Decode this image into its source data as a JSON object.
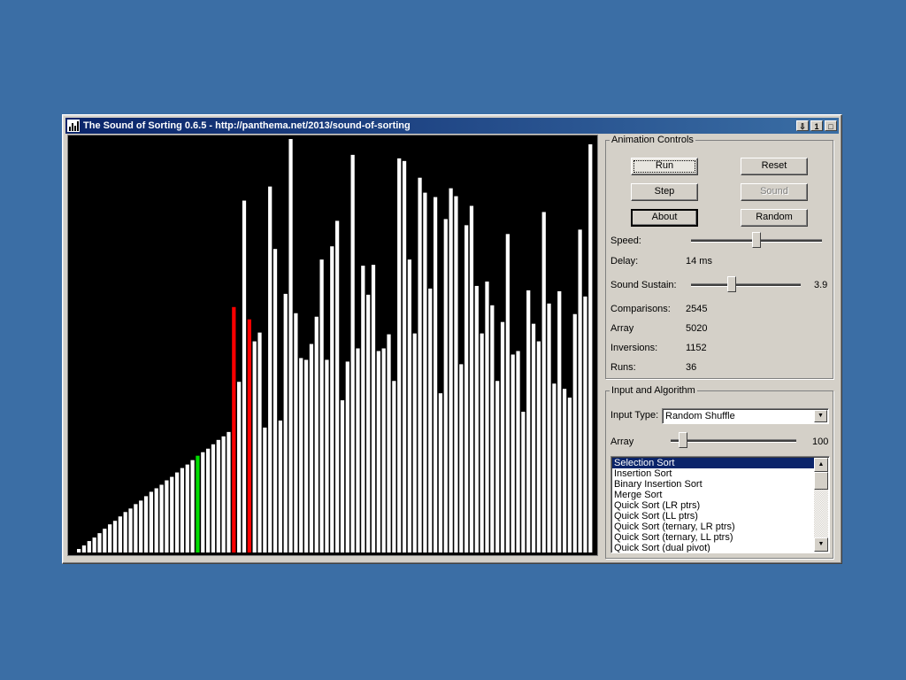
{
  "window": {
    "title": "The Sound of Sorting 0.6.5 - http://panthema.net/2013/sound-of-sorting",
    "buttons": [
      "⇩",
      "1",
      "□"
    ]
  },
  "visual": {
    "bar_color": "#ffffff",
    "compare_color": "#ff0000",
    "current_color": "#00dd00",
    "heights": [
      4,
      8,
      13,
      17,
      22,
      27,
      32,
      36,
      41,
      46,
      50,
      55,
      59,
      64,
      69,
      73,
      77,
      82,
      86,
      91,
      96,
      100,
      105,
      110,
      114,
      118,
      123,
      128,
      132,
      137,
      279,
      194,
      400,
      265,
      240,
      250,
      142,
      416,
      345,
      150,
      294,
      470,
      272,
      221,
      219,
      237,
      268,
      333,
      219,
      348,
      377,
      173,
      217,
      452,
      232,
      326,
      293,
      327,
      229,
      232,
      248,
      195,
      448,
      445,
      333,
      249,
      426,
      409,
      300,
      404,
      181,
      379,
      414,
      405,
      214,
      372,
      394,
      303,
      249,
      308,
      281,
      195,
      262,
      362,
      225,
      229,
      160,
      298,
      260,
      240,
      387,
      283,
      192,
      297,
      186,
      176,
      271,
      367,
      291,
      464
    ],
    "compare_indices": [
      30,
      33
    ],
    "current_index": 23
  },
  "animation_controls": {
    "legend": "Animation Controls",
    "run_label": "Run",
    "reset_label": "Reset",
    "step_label": "Step",
    "sound_label": "Sound",
    "about_label": "About",
    "random_label": "Random",
    "speed_label": "Speed:",
    "speed_fraction": 0.5,
    "delay_label": "Delay:",
    "delay_value": "14 ms",
    "sustain_label": "Sound Sustain:",
    "sustain_value": "3.9",
    "sustain_fraction": 0.36,
    "comparisons_label": "Comparisons:",
    "comparisons_value": "2545",
    "array_label": "Array",
    "array_value": "5020",
    "inversions_label": "Inversions:",
    "inversions_value": "1152",
    "runs_label": "Runs:",
    "runs_value": "36"
  },
  "input_algorithm": {
    "legend": "Input and Algorithm",
    "input_type_label": "Input Type:",
    "input_type_value": "Random Shuffle",
    "array_label": "Array",
    "array_size_value": "100",
    "array_size_fraction": 0.07,
    "algorithms": [
      "Selection Sort",
      "Insertion Sort",
      "Binary Insertion Sort",
      "Merge Sort",
      "Quick Sort (LR ptrs)",
      "Quick Sort (LL ptrs)",
      "Quick Sort (ternary, LR ptrs)",
      "Quick Sort (ternary, LL ptrs)",
      "Quick Sort (dual pivot)"
    ],
    "selected_index": 0
  }
}
